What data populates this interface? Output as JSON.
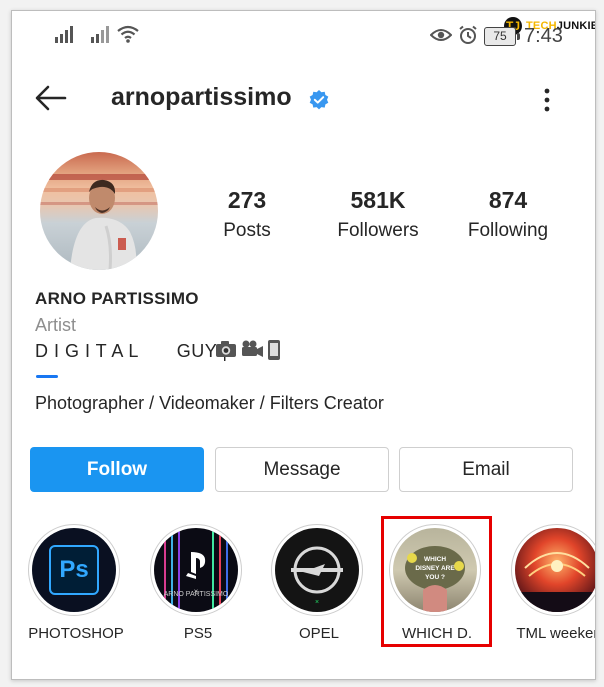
{
  "status_bar": {
    "time": "7:43",
    "battery": "75",
    "icons": [
      "signal-icon",
      "signal-icon",
      "wifi-icon",
      "eye-icon",
      "alarm-icon",
      "battery-icon"
    ]
  },
  "watermark": {
    "logo_letter": "TJ",
    "brand_part1": "TECH",
    "brand_part2": "JUNKIE"
  },
  "header": {
    "username": "arnopartissimo",
    "verified": true,
    "back_icon": "arrow-left-icon",
    "more_icon": "more-vertical-icon"
  },
  "profile": {
    "stats": [
      {
        "value": "273",
        "label": "Posts"
      },
      {
        "value": "581K",
        "label": "Followers"
      },
      {
        "value": "874",
        "label": "Following"
      }
    ],
    "full_name": "ARNO PARTISSIMO",
    "category": "Artist",
    "bio_line1": "D I G I T A L       GUY |",
    "bio_emojis": [
      "camera-icon",
      "video-camera-icon",
      "phone-icon"
    ],
    "bio_line2": "Photographer / Videomaker / Filters Creator"
  },
  "actions": {
    "follow": "Follow",
    "message": "Message",
    "email": "Email"
  },
  "highlights": [
    {
      "label": "PHOTOSHOP",
      "icon": "photoshop-icon",
      "icon_text": "Ps"
    },
    {
      "label": "PS5",
      "icon": "playstation-icon",
      "icon_text": "ARNO PARTISSIMO"
    },
    {
      "label": "OPEL",
      "icon": "opel-logo-icon"
    },
    {
      "label": "WHICH D.",
      "icon": "quiz-icon",
      "icon_text": "WHICH DISNEY ARE YOU ?",
      "selected": true
    },
    {
      "label": "TML weeken",
      "icon": "concert-icon"
    }
  ],
  "colors": {
    "accent": "#1a95f1",
    "verified": "#3897f0",
    "selection_box": "#e60000",
    "text": "#262626",
    "muted": "#8e8e8e"
  }
}
